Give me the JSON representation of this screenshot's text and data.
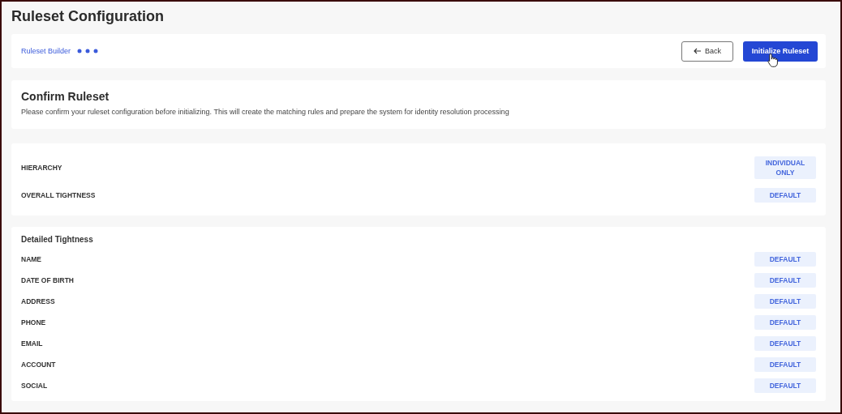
{
  "page": {
    "title": "Ruleset Configuration"
  },
  "toolbar": {
    "breadcrumb": "Ruleset Builder",
    "back_button": "Back",
    "primary_button": "Initialize Ruleset"
  },
  "confirm": {
    "title": "Confirm Ruleset",
    "description": "Please confirm your ruleset configuration before initializing. This will create the matching rules and prepare the system for identity resolution processing"
  },
  "summary": [
    {
      "label": "HIERARCHY",
      "value": "INDIVIDUAL ONLY"
    },
    {
      "label": "OVERALL TIGHTNESS",
      "value": "DEFAULT"
    }
  ],
  "detailed": {
    "title": "Detailed Tightness",
    "rows": [
      {
        "label": "NAME",
        "value": "DEFAULT"
      },
      {
        "label": "DATE OF BIRTH",
        "value": "DEFAULT"
      },
      {
        "label": "ADDRESS",
        "value": "DEFAULT"
      },
      {
        "label": "PHONE",
        "value": "DEFAULT"
      },
      {
        "label": "EMAIL",
        "value": "DEFAULT"
      },
      {
        "label": "ACCOUNT",
        "value": "DEFAULT"
      },
      {
        "label": "SOCIAL",
        "value": "DEFAULT"
      }
    ]
  }
}
